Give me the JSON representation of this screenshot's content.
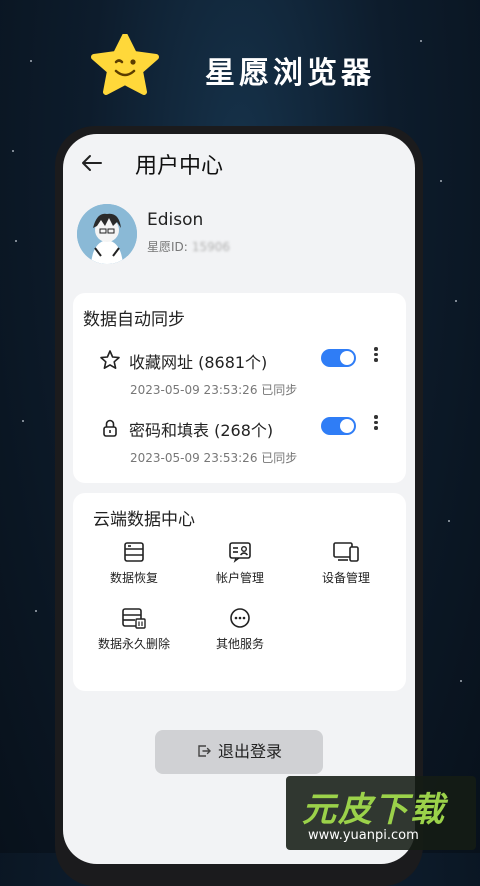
{
  "promo": {
    "title": "星愿浏览器"
  },
  "header": {
    "title": "用户中心"
  },
  "profile": {
    "name": "Edison",
    "id_label": "星愿ID:",
    "id_value": "15906"
  },
  "sync": {
    "title": "数据自动同步",
    "items": [
      {
        "label": "收藏网址 (8681个)",
        "time": "2023-05-09 23:53:26 已同步",
        "enabled": true,
        "icon": "star-icon"
      },
      {
        "label": "密码和填表 (268个)",
        "time": "2023-05-09 23:53:26 已同步",
        "enabled": true,
        "icon": "lock-icon"
      }
    ]
  },
  "cloud": {
    "title": "云端数据中心",
    "items": [
      {
        "label": "数据恢复",
        "icon": "data-restore-icon"
      },
      {
        "label": "帐户管理",
        "icon": "account-manage-icon"
      },
      {
        "label": "设备管理",
        "icon": "device-manage-icon"
      },
      {
        "label": "数据永久删除",
        "icon": "data-delete-icon"
      },
      {
        "label": "其他服务",
        "icon": "more-services-icon"
      }
    ]
  },
  "logout": {
    "label": "退出登录"
  },
  "watermark": {
    "title": "元皮下载",
    "url": "www.yuanpi.com"
  },
  "colors": {
    "accent": "#2f7df6",
    "screen_bg": "#f2f3f5"
  }
}
